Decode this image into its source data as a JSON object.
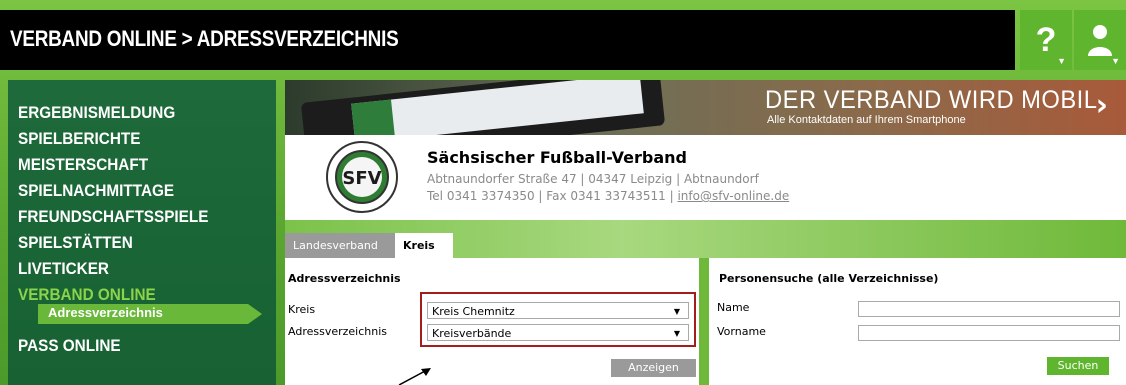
{
  "header": {
    "title": "VERBAND ONLINE > ADRESSVERZEICHNIS",
    "help_icon": "?",
    "user_icon": "user-icon"
  },
  "sidebar": {
    "items": [
      "ERGEBNISMELDUNG",
      "SPIELBERICHTE",
      "MEISTERSCHAFT",
      "SPIELNACHMITTAGE",
      "FREUNDSCHAFTSSPIELE",
      "SPIELSTÄTTEN",
      "LIVETICKER",
      "VERBAND ONLINE"
    ],
    "active_sub": "Adressverzeichnis",
    "last": "PASS ONLINE"
  },
  "banner": {
    "title": "DER VERBAND WIRD MOBIL",
    "subtitle": "Alle Kontaktdaten auf Ihrem Smartphone",
    "arrow": "›"
  },
  "club": {
    "name": "Sächsischer Fußball-Verband",
    "address": "Abtnaundorfer Straße 47 | 04347 Leipzig | Abtnaundorf",
    "contact_prefix": "Tel 0341 3374350 | Fax 0341 33743511 | ",
    "email": "info@sfv-online.de",
    "logo_text": "SFV"
  },
  "tabs": {
    "landes": "Landesverband",
    "kreis": "Kreis"
  },
  "left_panel": {
    "title": "Adressverzeichnis",
    "kreis_label": "Kreis",
    "kreis_value": "Kreis Chemnitz",
    "verzeichnis_label": "Adressverzeichnis",
    "verzeichnis_value": "Kreisverbände",
    "button": "Anzeigen"
  },
  "right_panel": {
    "title": "Personensuche (alle Verzeichnisse)",
    "name_label": "Name",
    "vorname_label": "Vorname",
    "button": "Suchen"
  },
  "colors": {
    "accent_green": "#5fb52e",
    "sidebar_green": "#1e6a3a",
    "highlight_red": "#a41d1d"
  }
}
